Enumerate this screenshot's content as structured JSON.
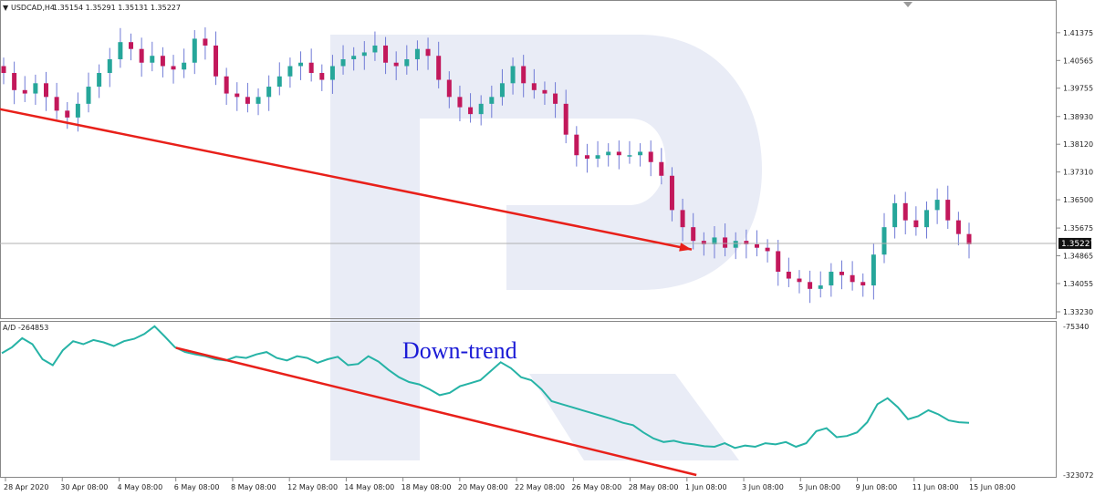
{
  "symbol_header": {
    "symbol": "USDCAD,H4",
    "values": "1.35154 1.35291 1.35131 1.35227"
  },
  "indicator_header": "A/D -264853",
  "annotation": "Down-trend",
  "current_price_label": "1.35227",
  "colors": {
    "bull_candle": "#26a69a",
    "bear_candle": "#c2185b",
    "wick": "#6f7ad6",
    "ad_line": "#26b3a6",
    "trend_line": "#e8201a",
    "annotation_text": "#1a1ad6",
    "watermark": "#e9ecf6"
  },
  "chart_data": [
    {
      "type": "candlestick",
      "title": "USDCAD,H4",
      "ylim": [
        1.3323,
        1.4185
      ],
      "y_ticks": [
        "1.41375",
        "1.40565",
        "1.39755",
        "1.38930",
        "1.38120",
        "1.37310",
        "1.36500",
        "1.35675",
        "1.34865",
        "1.34055",
        "1.33230"
      ],
      "close_series": [
        1.402,
        1.397,
        1.396,
        1.399,
        1.395,
        1.391,
        1.389,
        1.393,
        1.398,
        1.402,
        1.406,
        1.411,
        1.409,
        1.405,
        1.407,
        1.404,
        1.403,
        1.405,
        1.412,
        1.41,
        1.401,
        1.396,
        1.395,
        1.393,
        1.395,
        1.398,
        1.401,
        1.404,
        1.405,
        1.402,
        1.4,
        1.404,
        1.406,
        1.407,
        1.408,
        1.41,
        1.405,
        1.404,
        1.406,
        1.409,
        1.407,
        1.4,
        1.395,
        1.392,
        1.39,
        1.393,
        1.395,
        1.399,
        1.404,
        1.399,
        1.397,
        1.396,
        1.393,
        1.384,
        1.378,
        1.377,
        1.378,
        1.379,
        1.378,
        1.378,
        1.379,
        1.376,
        1.372,
        1.362,
        1.357,
        1.353,
        1.352,
        1.354,
        1.351,
        1.353,
        1.352,
        1.351,
        1.35,
        1.344,
        1.342,
        1.341,
        1.339,
        1.34,
        1.344,
        1.343,
        1.341,
        1.34,
        1.349,
        1.357,
        1.364,
        1.359,
        1.357,
        1.362,
        1.365,
        1.359,
        1.355,
        1.352
      ],
      "trend_line": {
        "from": [
          "7 May 04:00",
          1.3915
        ],
        "to": [
          "1 Jun 12:00",
          1.3505
        ]
      },
      "current_price": 1.35227
    },
    {
      "type": "line",
      "title": "A/D",
      "ylim": [
        -323072,
        -75340
      ],
      "y_ticks": [
        "-75340",
        "-323072"
      ],
      "series": [
        {
          "values": [
            -120000,
            -110000,
            -95000,
            -105000,
            -130000,
            -140000,
            -115000,
            -100000,
            -105000,
            -98000,
            -102000,
            -108000,
            -100000,
            -96000,
            -88000,
            -75000,
            -92000,
            -110000,
            -118000,
            -122000,
            -125000,
            -130000,
            -132000,
            -126000,
            -128000,
            -122000,
            -118000,
            -128000,
            -132000,
            -125000,
            -128000,
            -136000,
            -130000,
            -126000,
            -140000,
            -138000,
            -125000,
            -134000,
            -148000,
            -160000,
            -168000,
            -172000,
            -180000,
            -190000,
            -186000,
            -175000,
            -170000,
            -165000,
            -150000,
            -135000,
            -145000,
            -160000,
            -165000,
            -180000,
            -200000,
            -205000,
            -210000,
            -215000,
            -220000,
            -225000,
            -230000,
            -236000,
            -240000,
            -252000,
            -262000,
            -268000,
            -266000,
            -270000,
            -272000,
            -275000,
            -276000,
            -270000,
            -278000,
            -274000,
            -276000,
            -270000,
            -272000,
            -268000,
            -276000,
            -270000,
            -250000,
            -245000,
            -260000,
            -258000,
            -252000,
            -235000,
            -205000,
            -195000,
            -210000,
            -230000,
            -225000,
            -215000,
            -222000,
            -232000,
            -235000,
            -236000
          ]
        }
      ],
      "trend_line": {
        "from": [
          "6 May 08:00",
          -111000
        ],
        "to": [
          "1 Jun 16:00",
          -323072
        ]
      }
    }
  ],
  "x_axis_labels": [
    "28 Apr 2020",
    "30 Apr 08:00",
    "4 May 08:00",
    "6 May 08:00",
    "8 May 08:00",
    "12 May 08:00",
    "14 May 08:00",
    "18 May 08:00",
    "20 May 08:00",
    "22 May 08:00",
    "26 May 08:00",
    "28 May 08:00",
    "1 Jun 08:00",
    "3 Jun 08:00",
    "5 Jun 08:00",
    "9 Jun 08:00",
    "11 Jun 08:00",
    "15 Jun 08:00"
  ]
}
